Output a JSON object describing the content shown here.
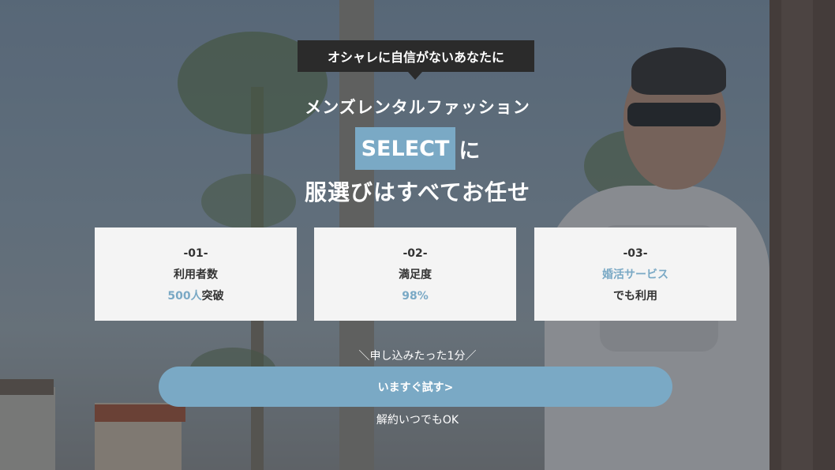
{
  "hero": {
    "tagline": "オシャレに自信がないあなたに",
    "subtitle": "メンズレンタルファッション",
    "brand": "SELECT",
    "brand_suffix": "に",
    "headline": "服選びはすべてお任せ"
  },
  "stats": [
    {
      "number": "-01-",
      "label": "利用者数",
      "value_accent": "500人",
      "value_rest": "突破"
    },
    {
      "number": "-02-",
      "label": "満足度",
      "value_accent": "98%",
      "value_rest": ""
    },
    {
      "number": "-03-",
      "label_accent": "婚活サービス",
      "value": "でも利用"
    }
  ],
  "cta": {
    "caption": "＼申し込みたった1分／",
    "button_label": "いますぐ試す>",
    "note": "解約いつでもOK"
  },
  "colors": {
    "accent": "#7aa9c5",
    "tagline_bg": "#2b2b2b",
    "card_bg": "#f4f4f4"
  }
}
